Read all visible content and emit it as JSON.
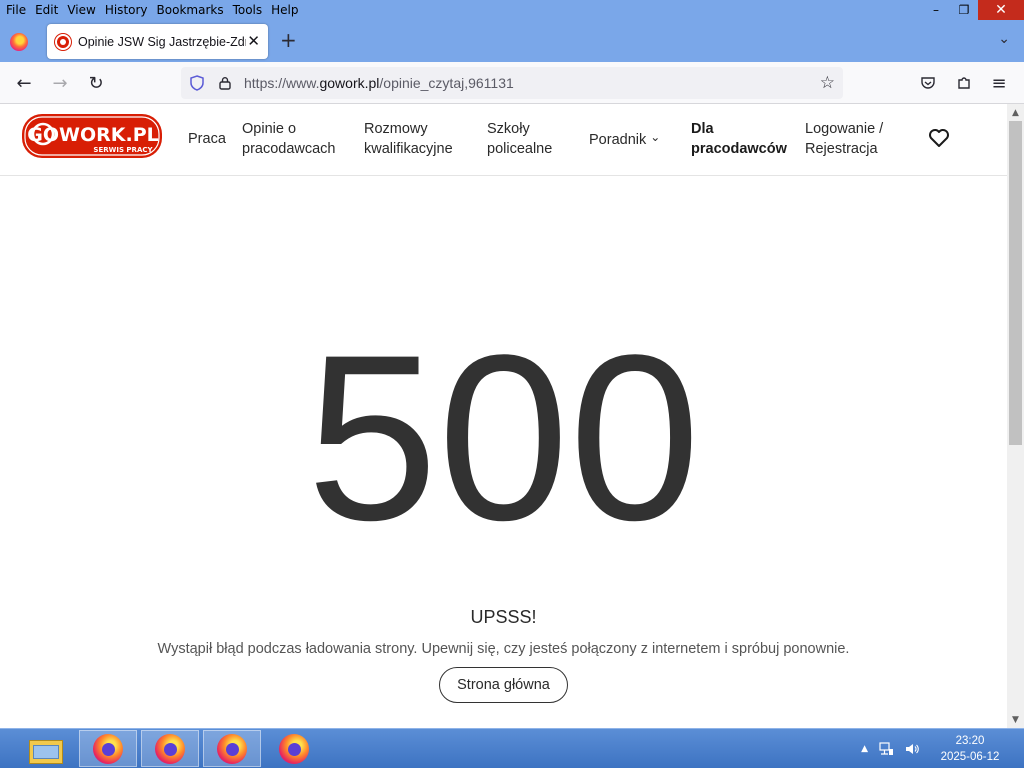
{
  "menubar": {
    "items": [
      {
        "label": "File"
      },
      {
        "label": "Edit"
      },
      {
        "label": "View"
      },
      {
        "label": "History"
      },
      {
        "label": "Bookmarks"
      },
      {
        "label": "Tools"
      },
      {
        "label": "Help"
      }
    ]
  },
  "window_controls": {
    "minimize": "–",
    "restore": "❐",
    "close": "✕"
  },
  "tab": {
    "title": "Opinie JSW Sig Jastrzębie-Zdrój",
    "close": "✕"
  },
  "newtab": "+",
  "tablist": "⌄",
  "navbar": {
    "back": "←",
    "forward": "→",
    "reload": "↻",
    "url_prefix": "https://www.",
    "url_host": "gowork.pl",
    "url_path": "/opinie_czytaj,961131",
    "star": "☆",
    "menu": "≡"
  },
  "site": {
    "logo_text": "GOWORK.PL",
    "logo_sub": "SERWIS PRACY",
    "nav": {
      "praca": "Praca",
      "opinie_1": "Opinie o",
      "opinie_2": "pracodawcach",
      "rozmowy_1": "Rozmowy",
      "rozmowy_2": "kwalifikacyjne",
      "szkoly_1": "Szkoły",
      "szkoly_2": "policealne",
      "poradnik": "Poradnik",
      "poradnik_chevron": "⌄",
      "dla_1": "Dla",
      "dla_2": "pracodawców",
      "login_1": "Logowanie /",
      "login_2": "Rejestracja"
    }
  },
  "error": {
    "code": "500",
    "title": "UPSSS!",
    "message": "Wystąpił błąd podczas ładowania strony. Upewnij się, czy jesteś połączony z internetem i spróbuj ponownie.",
    "button": "Strona główna"
  },
  "scrollbar": {
    "up": "▲",
    "down": "▼"
  },
  "taskbar": {
    "tray_arrow": "▲",
    "time": "23:20",
    "date": "2025-06-12"
  },
  "colors": {
    "chrome": "#7aa7e9",
    "logo_red": "#d81e05",
    "close_red": "#c42b1c"
  }
}
